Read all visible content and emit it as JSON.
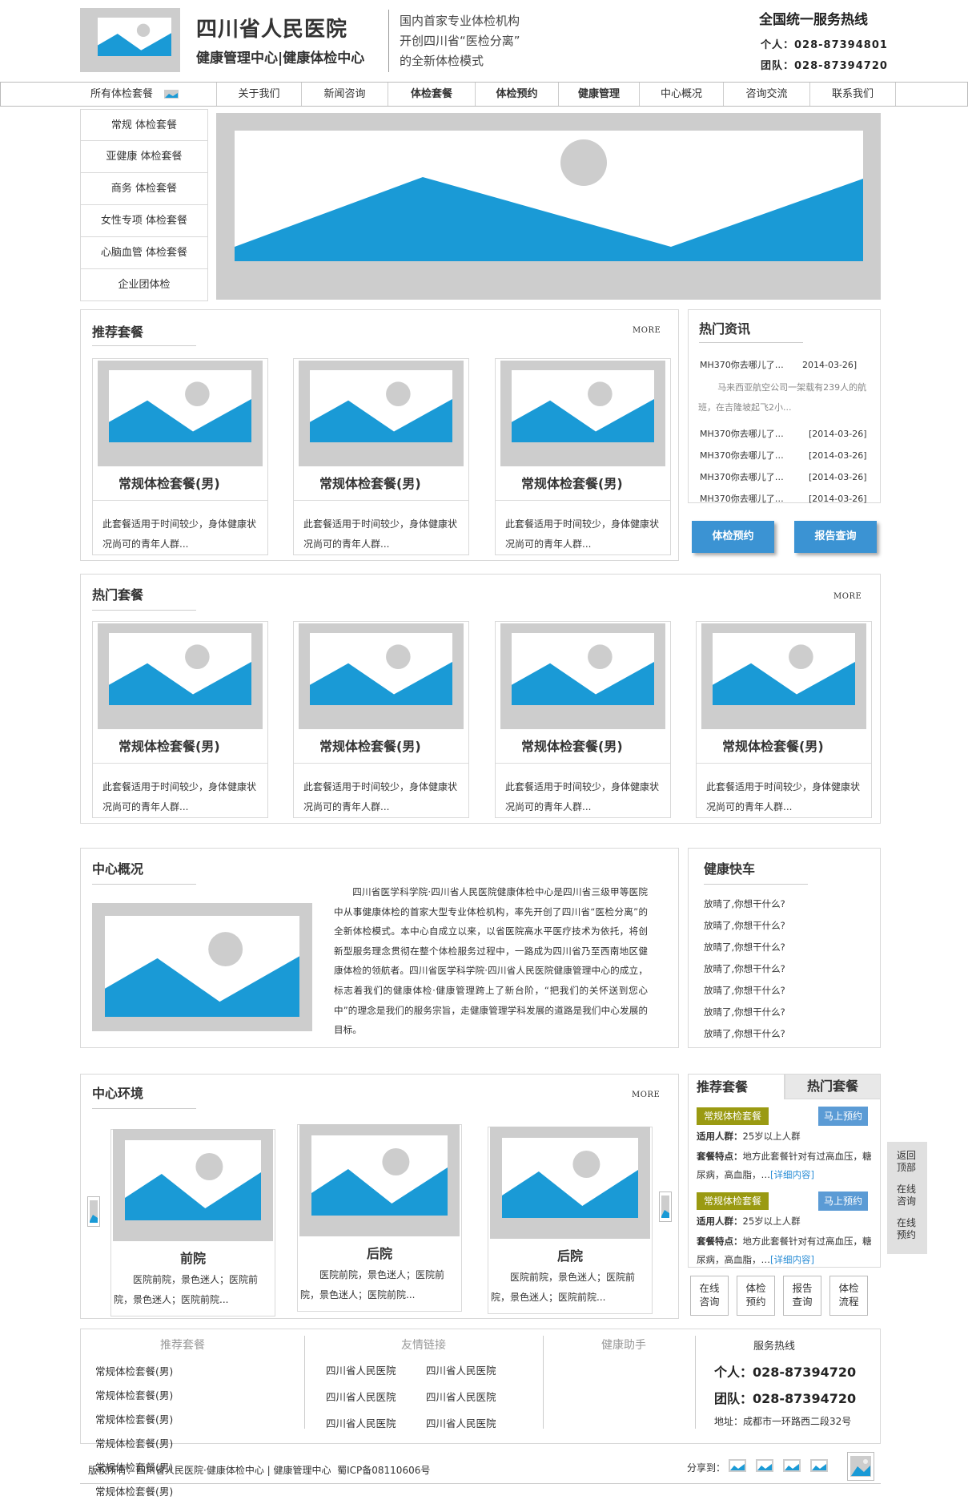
{
  "header": {
    "hospital_name": "四川省人民医院",
    "subtitle": "健康管理中心|健康体检中心",
    "slogan": [
      "国内首家专业体检机构",
      "开创四川省“医检分离”",
      "的全新体检模式"
    ],
    "hotline_title": "全国统一服务热线",
    "personal_label": "个人：",
    "personal_phone": "028-87394801",
    "team_label": "团队：",
    "team_phone": "028-87394720"
  },
  "nav": {
    "all_packages": "所有体检套餐",
    "items": [
      {
        "label": "关于我们",
        "bold": false
      },
      {
        "label": "新闻咨询",
        "bold": false
      },
      {
        "label": "体检套餐",
        "bold": true
      },
      {
        "label": "体检预约",
        "bold": true
      },
      {
        "label": "健康管理",
        "bold": true
      },
      {
        "label": "中心概况",
        "bold": false
      },
      {
        "label": "咨询交流",
        "bold": false
      },
      {
        "label": "联系我们",
        "bold": false
      }
    ]
  },
  "side_menu": [
    "常规 体检套餐",
    "亚健康 体检套餐",
    "商务 体检套餐",
    "女性专项 体检套餐",
    "心脑血管 体检套餐",
    "企业团体检"
  ],
  "recommended": {
    "title": "推荐套餐",
    "more": "MORE",
    "cards": [
      {
        "title": "常规体检套餐(男)",
        "desc": "此套餐适用于时间较少，身体健康状况尚可的青年人群..."
      },
      {
        "title": "常规体检套餐(男)",
        "desc": "此套餐适用于时间较少，身体健康状况尚可的青年人群..."
      },
      {
        "title": "常规体检套餐(男)",
        "desc": "此套餐适用于时间较少，身体健康状况尚可的青年人群..."
      }
    ]
  },
  "hot_news": {
    "title": "热门资讯",
    "first": {
      "title": "MH370你去哪儿了…",
      "date": "2014-03-26]"
    },
    "excerpt": "马来西亚航空公司一架载有239人的航班，在吉隆坡起飞2小...",
    "items": [
      {
        "title": "MH370你去哪儿了…",
        "date": "[2014-03-26]"
      },
      {
        "title": "MH370你去哪儿了…",
        "date": "[2014-03-26]"
      },
      {
        "title": "MH370你去哪儿了…",
        "date": "[2014-03-26]"
      },
      {
        "title": "MH370你去哪儿了…",
        "date": "[2014-03-26]"
      }
    ],
    "btn_booking": "体检预约",
    "btn_report": "报告查询"
  },
  "hot_packages": {
    "title": "热门套餐",
    "more": "MORE",
    "cards": [
      {
        "title": "常规体检套餐(男)",
        "desc": "此套餐适用于时间较少，身体健康状况尚可的青年人群..."
      },
      {
        "title": "常规体检套餐(男)",
        "desc": "此套餐适用于时间较少，身体健康状况尚可的青年人群..."
      },
      {
        "title": "常规体检套餐(男)",
        "desc": "此套餐适用于时间较少，身体健康状况尚可的青年人群..."
      },
      {
        "title": "常规体检套餐(男)",
        "desc": "此套餐适用于时间较少，身体健康状况尚可的青年人群..."
      }
    ]
  },
  "overview": {
    "title": "中心概况",
    "text": "四川省医学科学院·四川省人民医院健康体检中心是四川省三级甲等医院中从事健康体检的首家大型专业体检机构，率先开创了四川省“医检分离”的全新体检模式。本中心自成立以来，以省医院高水平医疗技术为依托，将创新型服务理念贯彻在整个体检服务过程中，一路成为四川省乃至西南地区健康体检的领航者。四川省医学科学院·四川省人民医院健康管理中心的成立，标志着我们的健康体检·健康管理跨上了新台阶，“把我们的关怀送到您心中”的理念是我们的服务宗旨，走健康管理学科发展的道路是我们中心发展的目标。"
  },
  "health_express": {
    "title": "健康快车",
    "items": [
      "放晴了,你想干什么?",
      "放晴了,你想干什么?",
      "放晴了,你想干什么?",
      "放晴了,你想干什么?",
      "放晴了,你想干什么?",
      "放晴了,你想干什么?",
      "放晴了,你想干什么?"
    ]
  },
  "environment": {
    "title": "中心环境",
    "more": "MORE",
    "items": [
      {
        "name": "前院",
        "desc": "医院前院，景色迷人；医院前院，景色迷人；医院前院..."
      },
      {
        "name": "后院",
        "desc": "医院前院，景色迷人；医院前院，景色迷人；医院前院..."
      },
      {
        "name": "后院",
        "desc": "医院前院，景色迷人；医院前院，景色迷人；医院前院..."
      }
    ]
  },
  "tabs_panel": {
    "tab_recommended": "推荐套餐",
    "tab_hot": "热门套餐",
    "entries": [
      {
        "badge": "常规体检套餐",
        "book": "马上预约",
        "people_label": "适用人群：",
        "people": "25岁以上人群",
        "feature_label": "套餐特点：",
        "feature": "地方此套餐针对有过高血压，糖尿病，高血脂，…",
        "detail": "[详细内容]"
      },
      {
        "badge": "常规体检套餐",
        "book": "马上预约",
        "people_label": "适用人群：",
        "people": "25岁以上人群",
        "feature_label": "套餐特点：",
        "feature": "地方此套餐针对有过高血压，糖尿病，高血脂，…",
        "detail": "[详细内容]"
      }
    ],
    "quick": [
      "在线咨询",
      "体检预约",
      "报告查询",
      "体检流程"
    ]
  },
  "float_bar": [
    "返回顶部",
    "在线咨询",
    "在线预约"
  ],
  "footer": {
    "col_recommended": "推荐套餐",
    "recommended_links": [
      "常规体检套餐(男)",
      "常规体检套餐(男)",
      "常规体检套餐(男)",
      "常规体检套餐(男)",
      "常规体检套餐(男)",
      "常规体检套餐(男)"
    ],
    "col_friends": "友情链接",
    "friend_links": [
      "四川省人民医院",
      "四川省人民医院",
      "四川省人民医院",
      "四川省人民医院",
      "四川省人民医院",
      "四川省人民医院"
    ],
    "col_assistant": "健康助手",
    "col_hotline": "服务热线",
    "personal": "个人：028-87394720",
    "team": "团队：028-87394720",
    "address": "地址：成都市一环路西二段32号",
    "copyright": "版权所有：四川省人民医院·健康体检中心 | 健康管理中心  蜀ICP备08110606号",
    "share": "分享到："
  },
  "colors": {
    "accent_blue": "#1a9ad6",
    "badge_olive": "#9a9a12",
    "book_blue": "#5b9bd5",
    "placeholder_gray": "#cdcdcd"
  }
}
